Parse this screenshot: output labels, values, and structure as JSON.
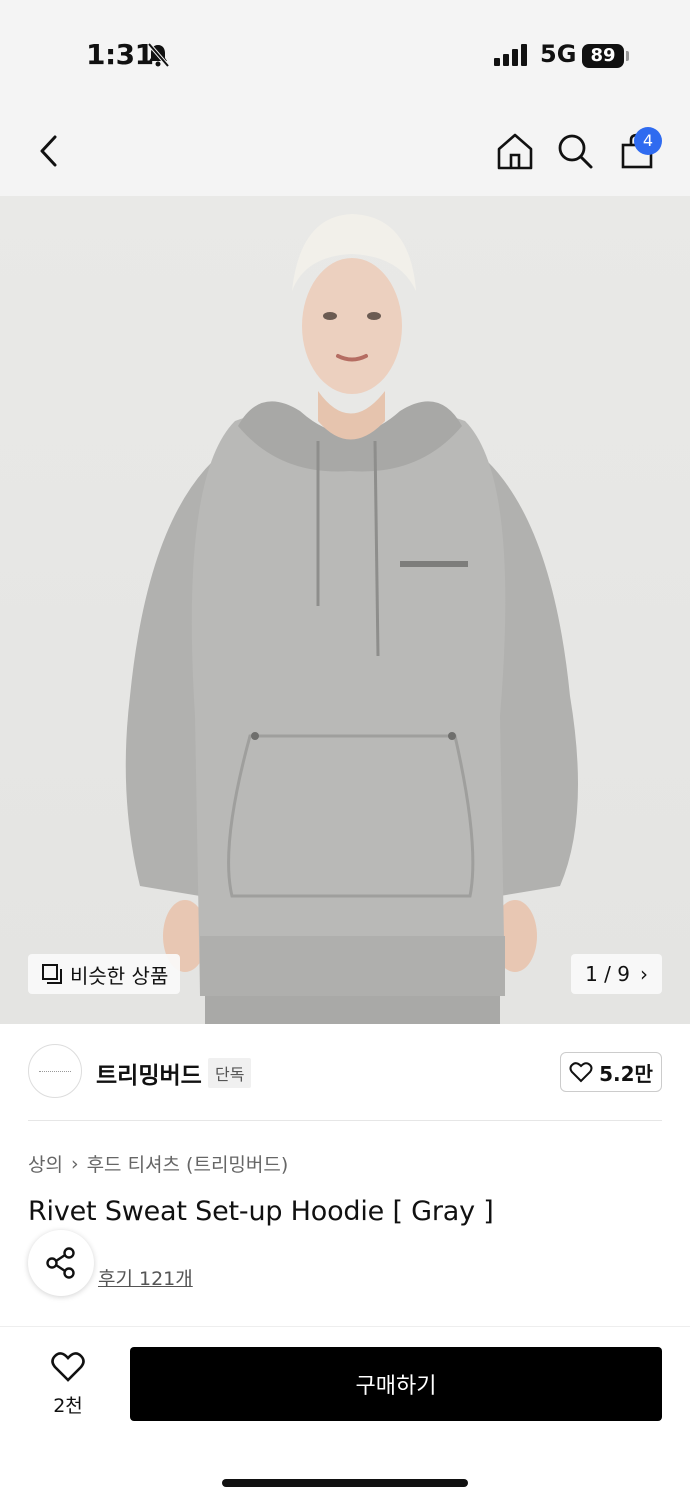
{
  "status": {
    "time": "1:31",
    "network": "5G",
    "battery": "89"
  },
  "header": {
    "cart_count": "4",
    "icons": [
      "chevron-left-icon",
      "home-icon",
      "search-icon",
      "bag-icon"
    ]
  },
  "gallery": {
    "similar_label": "비슷한 상품",
    "counter": "1 / 9"
  },
  "brand": {
    "name": "트리밍버드",
    "badge": "단독",
    "likes": "5.2만"
  },
  "breadcrumb": {
    "category": "상의",
    "subcategory": "후드 티셔츠 (트리밍버드)"
  },
  "product": {
    "title": "Rivet Sweat Set-up Hoodie [ Gray ]",
    "reviews": "후기 121개"
  },
  "bottom_bar": {
    "wish_count": "2천",
    "buy_label": "구매하기"
  },
  "colors": {
    "accent": "#2f6bf0",
    "buy_button": "#000000",
    "header_bg": "#f4f4f4"
  }
}
